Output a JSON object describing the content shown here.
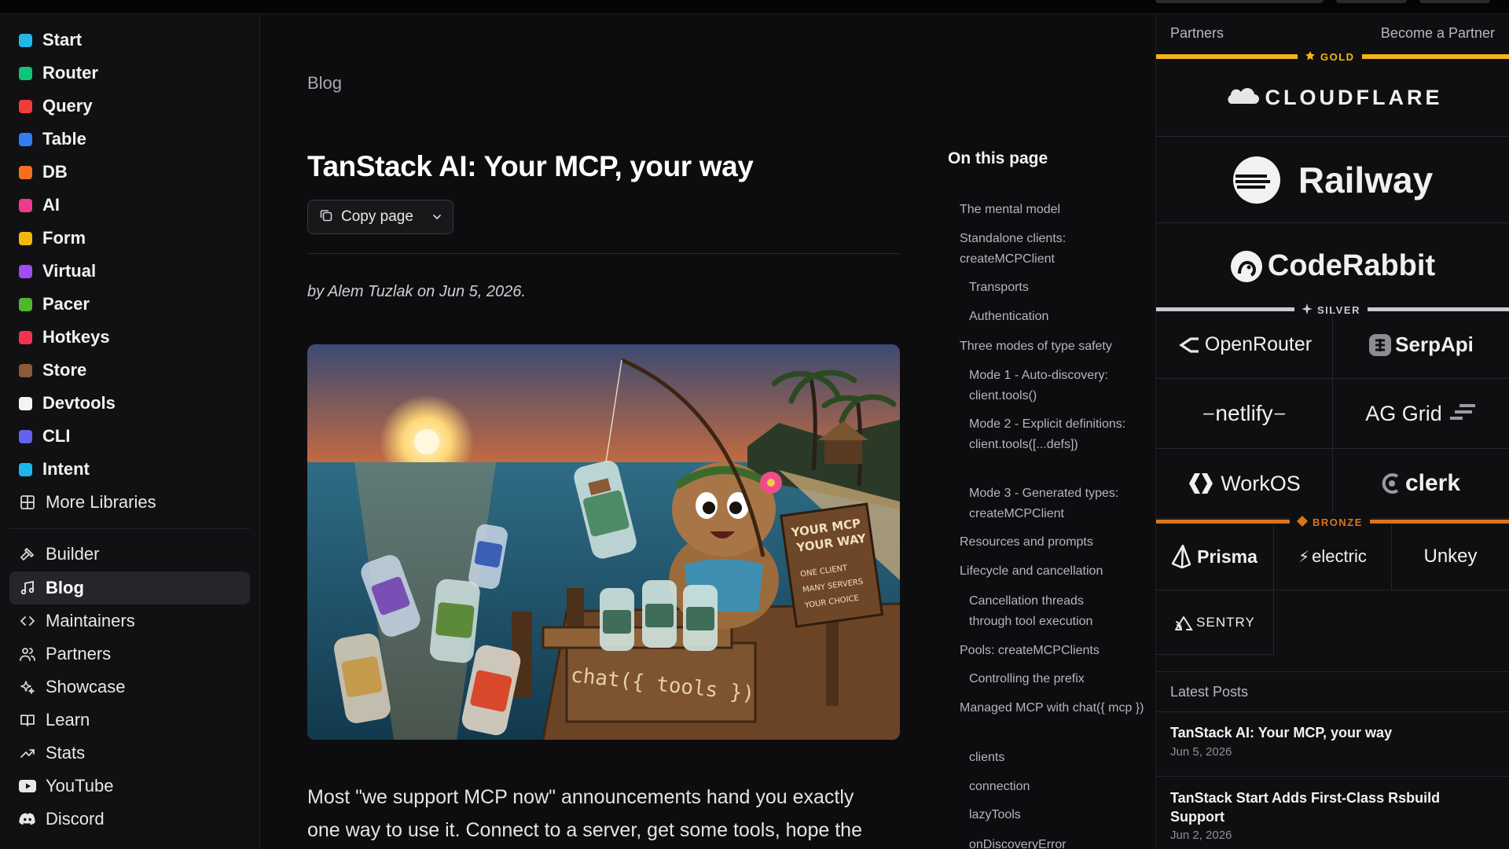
{
  "libraries": [
    {
      "label": "Start",
      "color": "#22b8e6"
    },
    {
      "label": "Router",
      "color": "#10c47a"
    },
    {
      "label": "Query",
      "color": "#f03c3c"
    },
    {
      "label": "Table",
      "color": "#2f7ef5"
    },
    {
      "label": "DB",
      "color": "#f5701e"
    },
    {
      "label": "AI",
      "color": "#ee3a8c"
    },
    {
      "label": "Form",
      "color": "#f2b90c"
    },
    {
      "label": "Virtual",
      "color": "#a24bf2"
    },
    {
      "label": "Pacer",
      "color": "#4db82e"
    },
    {
      "label": "Hotkeys",
      "color": "#f0344f"
    },
    {
      "label": "Store",
      "color": "#8b5a3a"
    },
    {
      "label": "Devtools",
      "color": "#f4f4f4"
    },
    {
      "label": "CLI",
      "color": "#6262f0"
    },
    {
      "label": "Intent",
      "color": "#1eb7ea"
    }
  ],
  "more_libraries": "More Libraries",
  "nav": [
    {
      "label": "Builder",
      "icon": "hammer-icon"
    },
    {
      "label": "Blog",
      "icon": "music-note-icon"
    },
    {
      "label": "Maintainers",
      "icon": "code-brackets-icon"
    },
    {
      "label": "Partners",
      "icon": "users-icon"
    },
    {
      "label": "Showcase",
      "icon": "sparkles-icon"
    },
    {
      "label": "Learn",
      "icon": "book-icon"
    },
    {
      "label": "Stats",
      "icon": "trending-up-icon"
    },
    {
      "label": "YouTube",
      "icon": "youtube-icon"
    },
    {
      "label": "Discord",
      "icon": "discord-icon"
    }
  ],
  "article": {
    "breadcrumb": "Blog",
    "title": "TanStack AI: Your MCP, your way",
    "copy_label": "Copy page",
    "byline": "by Alem Tuzlak on Jun 5, 2026.",
    "hero_crate_text": "chat({ tools })",
    "hero_sign": [
      "YOUR MCP",
      "YOUR WAY",
      "ONE CLIENT",
      "MANY SERVERS",
      "YOUR CHOICE"
    ],
    "body_lines": [
      "Most \"we support MCP now\" announcements hand you exactly",
      "one way to use it. Connect to a server, get some tools, hope the"
    ]
  },
  "toc": {
    "title": "On this page",
    "items": [
      {
        "text": "The mental model",
        "indent": false
      },
      {
        "text": "Standalone clients: createMCPClient",
        "indent": false
      },
      {
        "text": "Transports",
        "indent": true
      },
      {
        "text": "Authentication",
        "indent": true
      },
      {
        "text": "Three modes of type safety",
        "indent": false
      },
      {
        "text": "Mode 1 - Auto-discovery: client.tools()",
        "indent": true
      },
      {
        "text": "Mode 2 - Explicit definitions: client.tools([...defs])",
        "indent": true
      },
      {
        "text": "Mode 3 - Generated types: createMCPClient",
        "indent": true
      },
      {
        "text": "Resources and prompts",
        "indent": false
      },
      {
        "text": "Lifecycle and cancellation",
        "indent": false
      },
      {
        "text": "Cancellation threads through tool execution",
        "indent": true
      },
      {
        "text": "Pools: createMCPClients",
        "indent": false
      },
      {
        "text": "Controlling the prefix",
        "indent": true
      },
      {
        "text": "Managed MCP with chat({ mcp })",
        "indent": false
      },
      {
        "text": "clients",
        "indent": true
      },
      {
        "text": "connection",
        "indent": true
      },
      {
        "text": "lazyTools",
        "indent": true
      },
      {
        "text": "onDiscoveryError",
        "indent": true
      }
    ]
  },
  "partners": {
    "heading": "Partners",
    "become": "Become a Partner",
    "tiers": {
      "gold": {
        "label": "GOLD",
        "color": "#f5b21a"
      },
      "silver": {
        "label": "SILVER",
        "color": "#c7cbd6"
      },
      "bronze": {
        "label": "BRONZE",
        "color": "#d9741c"
      }
    },
    "gold": [
      "CLOUDFLARE",
      "Railway",
      "CodeRabbit"
    ],
    "silver": [
      "OpenRouter",
      "SerpApi",
      "netlify",
      "AG Grid",
      "WorkOS",
      "clerk"
    ],
    "bronze": [
      "Prisma",
      "electric",
      "Unkey",
      "SENTRY"
    ]
  },
  "latest": {
    "heading": "Latest Posts",
    "posts": [
      {
        "title": "TanStack AI: Your MCP, your way",
        "date": "Jun 5, 2026"
      },
      {
        "title": "TanStack Start Adds First-Class Rsbuild Support",
        "date": "Jun 2, 2026"
      }
    ]
  }
}
